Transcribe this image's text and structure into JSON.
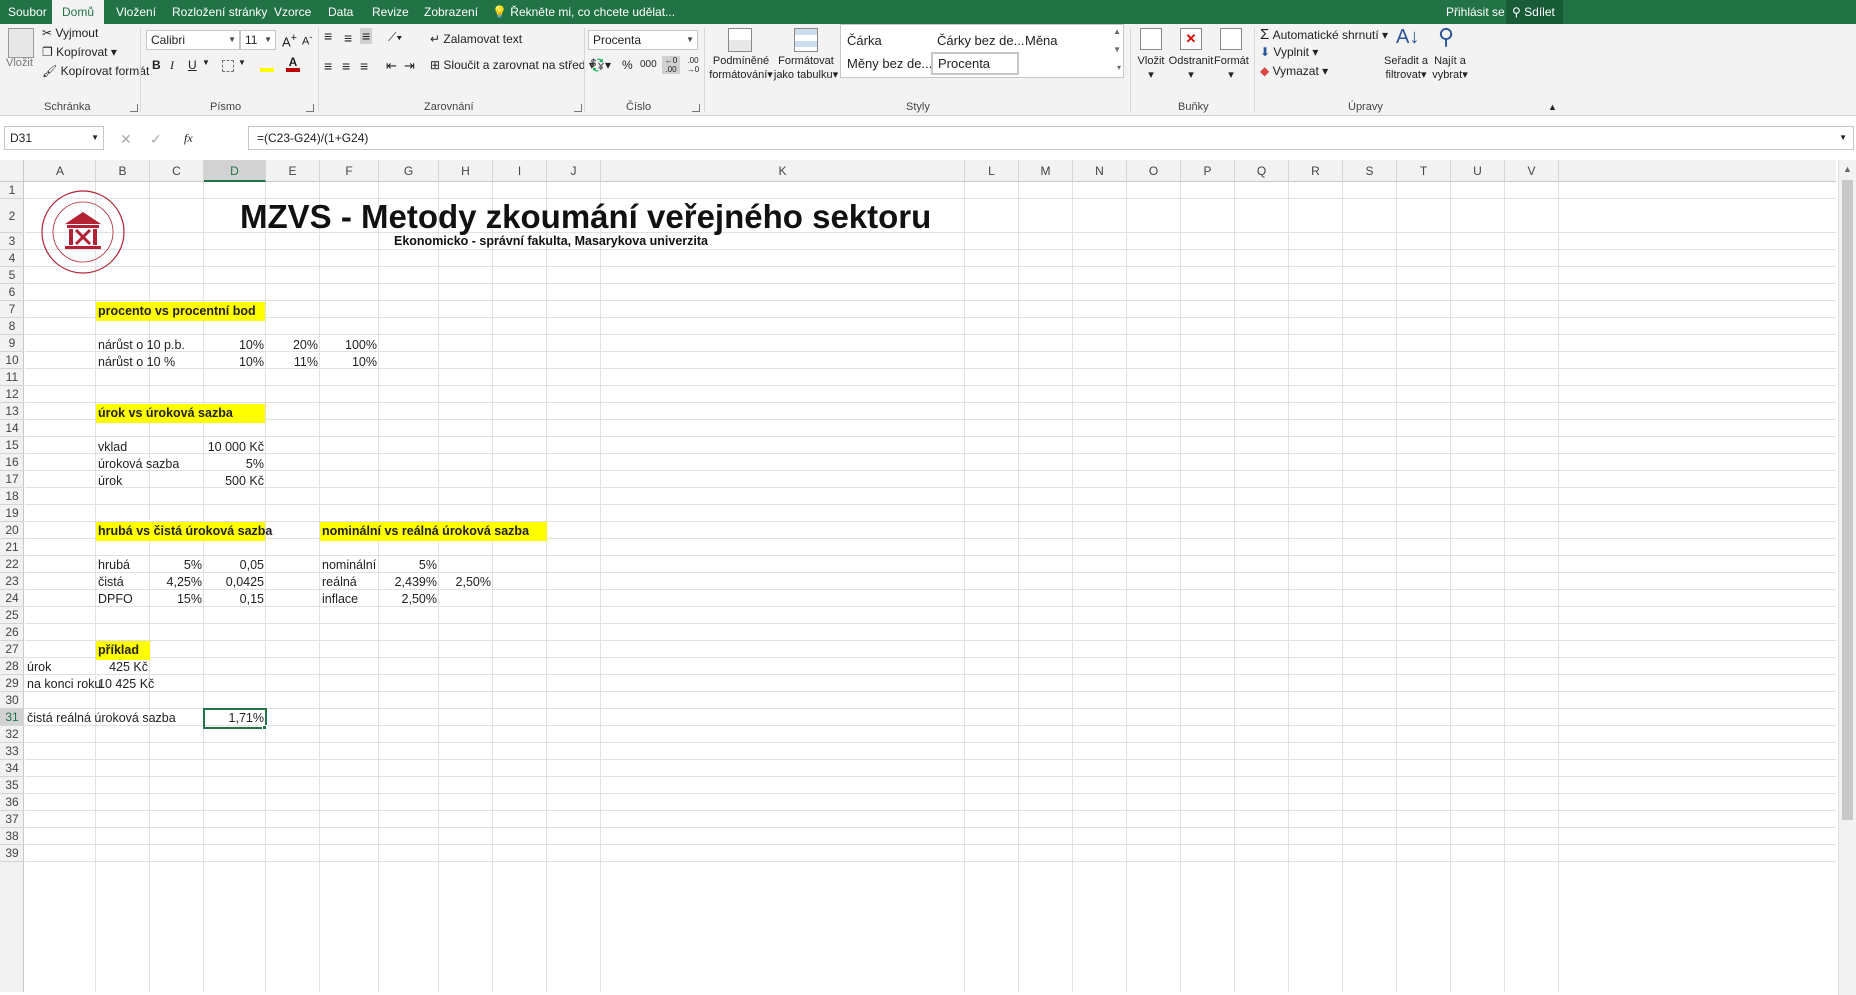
{
  "menu": {
    "tabs": [
      "Soubor",
      "Domů",
      "Vložení",
      "Rozložení stránky",
      "Vzorce",
      "Data",
      "Revize",
      "Zobrazení"
    ],
    "active_tab": "Domů",
    "tell_me": "Řekněte mi, co chcete udělat...",
    "sign_in": "Přihlásit se",
    "share": "Sdílet"
  },
  "ribbon": {
    "clipboard": {
      "paste": "Vložit",
      "cut": "Vyjmout",
      "copy": "Kopírovat",
      "format_painter": "Kopírovat formát",
      "label": "Schránka"
    },
    "font": {
      "name": "Calibri",
      "size": "11",
      "bold": "B",
      "italic": "I",
      "underline": "U",
      "label": "Písmo"
    },
    "alignment": {
      "wrap": "Zalamovat text",
      "merge": "Sloučit a zarovnat na střed",
      "label": "Zarovnání"
    },
    "number": {
      "format": "Procenta",
      "percent": "%",
      "thousands": "000",
      "label": "Číslo"
    },
    "styles": {
      "conditional": [
        "Podmíněné",
        "formátování"
      ],
      "as_table": [
        "Formátovat",
        "jako tabulku"
      ],
      "items": [
        "Čárka",
        "Čárky bez de...",
        "Měna",
        "Měny bez de...",
        "Procenta"
      ],
      "selected": "Procenta",
      "label": "Styly"
    },
    "cells": {
      "insert": "Vložit",
      "delete": "Odstranit",
      "format": "Formát",
      "label": "Buňky"
    },
    "editing": {
      "autosum": "Automatické shrnutí",
      "fill": "Vyplnit",
      "clear": "Vymazat",
      "sort": [
        "Seřadit a",
        "filtrovat"
      ],
      "find": [
        "Najít a",
        "vybrat"
      ],
      "label": "Úpravy"
    }
  },
  "formula_bar": {
    "name_box": "D31",
    "fx": "fx",
    "formula": "=(C23-G24)/(1+G24)"
  },
  "columns": [
    "A",
    "B",
    "C",
    "D",
    "E",
    "F",
    "G",
    "H",
    "I",
    "J",
    "K",
    "L",
    "M",
    "N",
    "O",
    "P",
    "Q",
    "R",
    "S",
    "T",
    "U",
    "V"
  ],
  "active_column": "D",
  "rows": [
    "1",
    "2",
    "3",
    "4",
    "5",
    "6",
    "7",
    "8",
    "9",
    "10",
    "11",
    "12",
    "13",
    "14",
    "15",
    "16",
    "17",
    "18",
    "19",
    "20",
    "21",
    "22",
    "23",
    "24",
    "25",
    "26",
    "27",
    "28",
    "29",
    "30",
    "31",
    "32",
    "33",
    "34",
    "35",
    "36",
    "37",
    "38",
    "39"
  ],
  "active_row": "31",
  "sheet": {
    "title": "MZVS - Metody zkoumání veřejného sektoru",
    "subtitle": "Ekonomicko - správní fakulta, Masarykova univerzita",
    "logo_text": "UNIVERSITAS MASARYKIANA BRUNENSIS · FACULTAS RERUM OECONOMICARUM",
    "sec1": {
      "header": "procento vs procentní bod",
      "r9": {
        "label": "nárůst o  10 p.b.",
        "d": "10%",
        "e": "20%",
        "f": "100%"
      },
      "r10": {
        "label": "nárůst  o  10 %",
        "d": "10%",
        "e": "11%",
        "f": "10%"
      }
    },
    "sec2": {
      "header": "úrok vs úroková sazba",
      "r15": {
        "label": "vklad",
        "val": "10 000 Kč"
      },
      "r16": {
        "label": "úroková sazba",
        "val": "5%"
      },
      "r17": {
        "label": "úrok",
        "val": "500 Kč"
      }
    },
    "sec3": {
      "header": "hrubá vs čistá úroková sazba",
      "r22": {
        "label": "hrubá",
        "c": "5%",
        "d": "0,05"
      },
      "r23": {
        "label": "čistá",
        "c": "4,25%",
        "d": "0,0425"
      },
      "r24": {
        "label": "DPFO",
        "c": "15%",
        "d": "0,15"
      }
    },
    "sec4": {
      "header": "nominální vs reálná úroková sazba",
      "r22": {
        "label": "nominální",
        "g": "5%"
      },
      "r23": {
        "label": "reálná",
        "g": "2,439%",
        "h": "2,50%"
      },
      "r24": {
        "label": "inflace",
        "g": "2,50%"
      }
    },
    "sec5": {
      "header": "příklad",
      "r28": {
        "label": "úrok",
        "val": "425 Kč"
      },
      "r29": {
        "label": "na konci roku",
        "val": "10 425 Kč"
      },
      "r31": {
        "label": "čistá reálná úroková sazba",
        "val": "1,71%"
      }
    }
  },
  "colors": {
    "brand": "#217346",
    "highlight": "#ffff00",
    "logo": "#b22234"
  }
}
